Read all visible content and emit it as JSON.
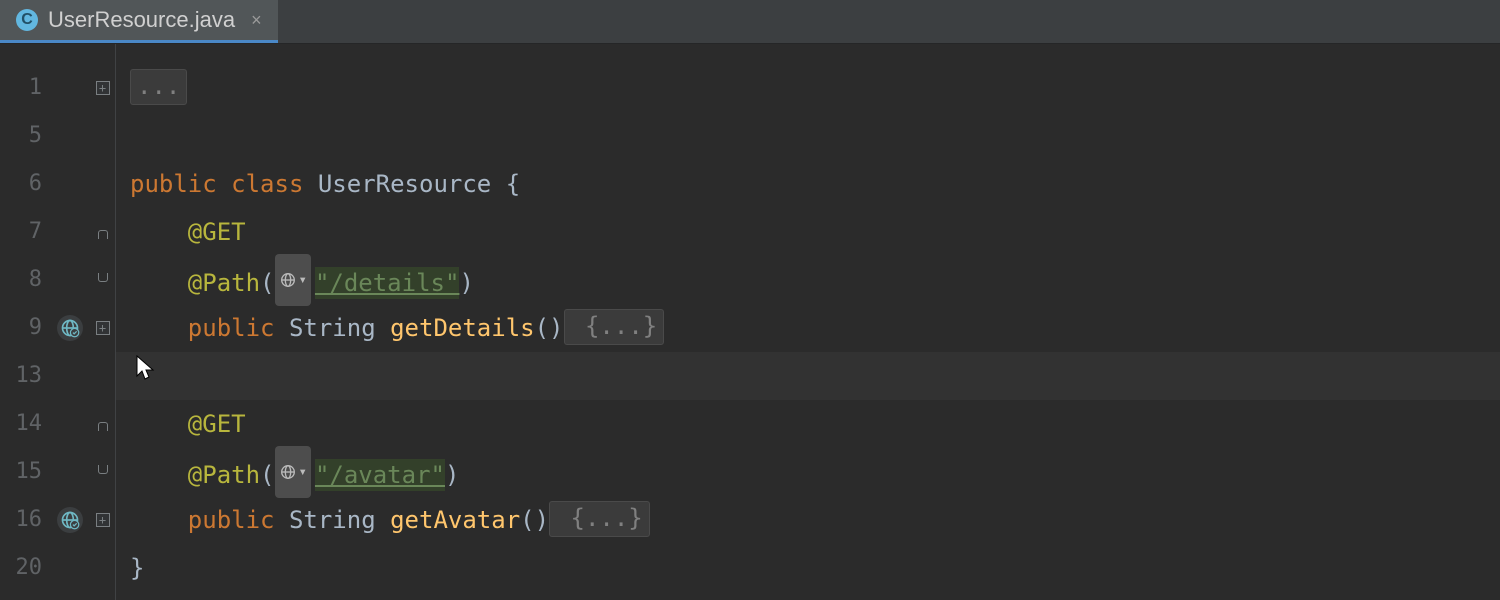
{
  "tab": {
    "icon_letter": "C",
    "filename": "UserResource.java"
  },
  "gutter": {
    "line_numbers": [
      "1",
      "5",
      "6",
      "7",
      "8",
      "9",
      "13",
      "14",
      "15",
      "16",
      "20"
    ]
  },
  "code": {
    "kw_public": "public",
    "kw_class": "class",
    "classname": "UserResource",
    "type_string": "String",
    "fold_dots": "...",
    "l1": {
      "fold": "..."
    },
    "l6": {
      "brace": " {"
    },
    "l7": {
      "ann": "@GET"
    },
    "l8": {
      "ann": "@Path",
      "path": "\"/details\""
    },
    "l9": {
      "method": "getDetails",
      "parens": "()",
      "fold": " {...}"
    },
    "l14": {
      "ann": "@GET"
    },
    "l15": {
      "ann": "@Path",
      "path": "\"/avatar\""
    },
    "l16": {
      "method": "getAvatar",
      "parens": "()",
      "fold": " {...}"
    },
    "l20": {
      "brace": "}"
    }
  }
}
